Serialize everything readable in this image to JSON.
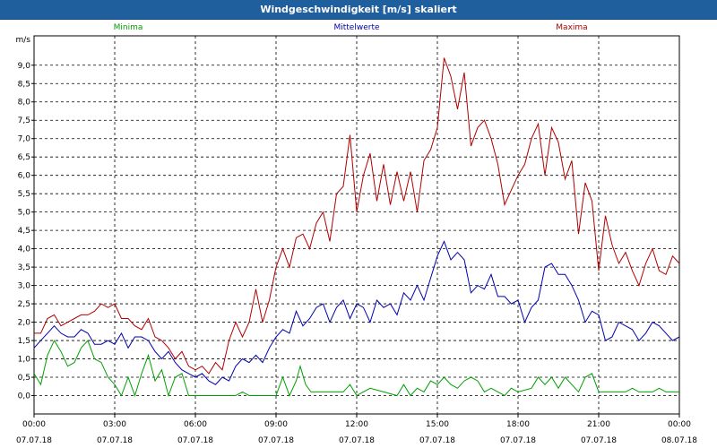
{
  "window": {
    "title": "Windgeschwindigkeit [m/s] skaliert"
  },
  "chart_data": {
    "type": "line",
    "title": "Windgeschwindigkeit [m/s] skaliert",
    "ylabel": "m/s",
    "ylim": [
      -0.5,
      9.8
    ],
    "yticks": [
      0.0,
      0.5,
      1.0,
      1.5,
      2.0,
      2.5,
      3.0,
      3.5,
      4.0,
      4.5,
      5.0,
      5.5,
      6.0,
      6.5,
      7.0,
      7.5,
      8.0,
      8.5,
      9.0
    ],
    "ytick_labels": [
      "0,0",
      "0,5",
      "1,0",
      "1,5",
      "2,0",
      "2,5",
      "3,0",
      "3,5",
      "4,0",
      "4,5",
      "5,0",
      "5,5",
      "6,0",
      "6,5",
      "7,0",
      "7,5",
      "8,0",
      "8,5",
      "9,0"
    ],
    "xlim_hours": [
      0,
      24
    ],
    "xticks": [
      {
        "h": 0,
        "time": "00:00",
        "date": "07.07.18"
      },
      {
        "h": 3,
        "time": "03:00",
        "date": "07.07.18"
      },
      {
        "h": 6,
        "time": "06:00",
        "date": "07.07.18"
      },
      {
        "h": 9,
        "time": "09:00",
        "date": "07.07.18"
      },
      {
        "h": 12,
        "time": "12:00",
        "date": "07.07.18"
      },
      {
        "h": 15,
        "time": "15:00",
        "date": "07.07.18"
      },
      {
        "h": 18,
        "time": "18:00",
        "date": "07.07.18"
      },
      {
        "h": 21,
        "time": "21:00",
        "date": "07.07.18"
      },
      {
        "h": 24,
        "time": "00:00",
        "date": "08.07.18"
      }
    ],
    "grid": true,
    "legend_placement": "top",
    "series": [
      {
        "name": "Minima",
        "color": "#00a000",
        "points": [
          [
            0,
            0.6
          ],
          [
            0.25,
            0.3
          ],
          [
            0.5,
            1.1
          ],
          [
            0.75,
            1.5
          ],
          [
            1,
            1.2
          ],
          [
            1.25,
            0.8
          ],
          [
            1.5,
            0.9
          ],
          [
            1.75,
            1.3
          ],
          [
            2,
            1.5
          ],
          [
            2.25,
            1.0
          ],
          [
            2.5,
            0.9
          ],
          [
            2.75,
            0.5
          ],
          [
            3,
            0.3
          ],
          [
            3.25,
            0.0
          ],
          [
            3.5,
            0.5
          ],
          [
            3.75,
            0.0
          ],
          [
            4,
            0.6
          ],
          [
            4.25,
            1.1
          ],
          [
            4.5,
            0.4
          ],
          [
            4.75,
            0.7
          ],
          [
            5,
            0.0
          ],
          [
            5.25,
            0.5
          ],
          [
            5.5,
            0.6
          ],
          [
            5.75,
            0.0
          ],
          [
            6,
            0.0
          ],
          [
            7,
            0.0
          ],
          [
            7.5,
            0.0
          ],
          [
            7.75,
            0.1
          ],
          [
            8,
            0.0
          ],
          [
            9,
            0.0
          ],
          [
            9.25,
            0.5
          ],
          [
            9.5,
            0.0
          ],
          [
            9.75,
            0.4
          ],
          [
            9.9,
            0.8
          ],
          [
            10.1,
            0.3
          ],
          [
            10.3,
            0.1
          ],
          [
            11,
            0.1
          ],
          [
            11.5,
            0.1
          ],
          [
            11.75,
            0.3
          ],
          [
            12,
            0.0
          ],
          [
            12.5,
            0.2
          ],
          [
            13,
            0.1
          ],
          [
            13.5,
            0.0
          ],
          [
            13.75,
            0.3
          ],
          [
            14,
            0.0
          ],
          [
            14.25,
            0.2
          ],
          [
            14.5,
            0.1
          ],
          [
            14.75,
            0.4
          ],
          [
            15,
            0.3
          ],
          [
            15.25,
            0.5
          ],
          [
            15.5,
            0.3
          ],
          [
            15.75,
            0.2
          ],
          [
            16,
            0.4
          ],
          [
            16.25,
            0.5
          ],
          [
            16.5,
            0.4
          ],
          [
            16.75,
            0.1
          ],
          [
            17,
            0.2
          ],
          [
            17.5,
            0.0
          ],
          [
            17.75,
            0.2
          ],
          [
            18,
            0.1
          ],
          [
            18.5,
            0.2
          ],
          [
            18.75,
            0.5
          ],
          [
            19,
            0.3
          ],
          [
            19.25,
            0.5
          ],
          [
            19.5,
            0.2
          ],
          [
            19.75,
            0.5
          ],
          [
            20,
            0.3
          ],
          [
            20.25,
            0.1
          ],
          [
            20.5,
            0.5
          ],
          [
            20.75,
            0.6
          ],
          [
            21,
            0.1
          ],
          [
            22,
            0.1
          ],
          [
            22.25,
            0.2
          ],
          [
            22.5,
            0.1
          ],
          [
            23,
            0.1
          ],
          [
            23.25,
            0.2
          ],
          [
            23.5,
            0.1
          ],
          [
            24,
            0.1
          ]
        ]
      },
      {
        "name": "Mittelwerte",
        "color": "#0000b0",
        "points": [
          [
            0,
            1.3
          ],
          [
            0.25,
            1.5
          ],
          [
            0.5,
            1.7
          ],
          [
            0.75,
            1.9
          ],
          [
            1,
            1.7
          ],
          [
            1.25,
            1.6
          ],
          [
            1.5,
            1.6
          ],
          [
            1.75,
            1.8
          ],
          [
            2,
            1.7
          ],
          [
            2.25,
            1.4
          ],
          [
            2.5,
            1.4
          ],
          [
            2.75,
            1.5
          ],
          [
            3,
            1.4
          ],
          [
            3.25,
            1.7
          ],
          [
            3.5,
            1.3
          ],
          [
            3.75,
            1.6
          ],
          [
            4,
            1.6
          ],
          [
            4.25,
            1.5
          ],
          [
            4.5,
            1.2
          ],
          [
            4.75,
            1.0
          ],
          [
            5,
            1.2
          ],
          [
            5.25,
            0.9
          ],
          [
            5.5,
            0.7
          ],
          [
            5.75,
            0.6
          ],
          [
            6,
            0.5
          ],
          [
            6.25,
            0.6
          ],
          [
            6.5,
            0.4
          ],
          [
            6.75,
            0.3
          ],
          [
            7,
            0.5
          ],
          [
            7.25,
            0.4
          ],
          [
            7.5,
            0.8
          ],
          [
            7.75,
            1.0
          ],
          [
            8,
            0.9
          ],
          [
            8.25,
            1.1
          ],
          [
            8.5,
            0.9
          ],
          [
            8.75,
            1.3
          ],
          [
            9,
            1.6
          ],
          [
            9.25,
            1.8
          ],
          [
            9.5,
            1.7
          ],
          [
            9.75,
            2.3
          ],
          [
            10,
            1.9
          ],
          [
            10.25,
            2.1
          ],
          [
            10.5,
            2.4
          ],
          [
            10.75,
            2.5
          ],
          [
            11,
            2.0
          ],
          [
            11.25,
            2.4
          ],
          [
            11.5,
            2.6
          ],
          [
            11.75,
            2.1
          ],
          [
            12,
            2.5
          ],
          [
            12.25,
            2.4
          ],
          [
            12.5,
            2.0
          ],
          [
            12.75,
            2.6
          ],
          [
            13,
            2.4
          ],
          [
            13.25,
            2.5
          ],
          [
            13.5,
            2.2
          ],
          [
            13.75,
            2.8
          ],
          [
            14,
            2.6
          ],
          [
            14.25,
            3.0
          ],
          [
            14.5,
            2.6
          ],
          [
            14.75,
            3.2
          ],
          [
            15,
            3.8
          ],
          [
            15.25,
            4.2
          ],
          [
            15.5,
            3.7
          ],
          [
            15.75,
            3.9
          ],
          [
            16,
            3.7
          ],
          [
            16.25,
            2.8
          ],
          [
            16.5,
            3.0
          ],
          [
            16.75,
            2.9
          ],
          [
            17,
            3.3
          ],
          [
            17.25,
            2.7
          ],
          [
            17.5,
            2.7
          ],
          [
            17.75,
            2.5
          ],
          [
            18,
            2.6
          ],
          [
            18.25,
            2.0
          ],
          [
            18.5,
            2.4
          ],
          [
            18.75,
            2.6
          ],
          [
            19,
            3.5
          ],
          [
            19.25,
            3.6
          ],
          [
            19.5,
            3.3
          ],
          [
            19.75,
            3.3
          ],
          [
            20,
            3.0
          ],
          [
            20.25,
            2.6
          ],
          [
            20.5,
            2.0
          ],
          [
            20.75,
            2.3
          ],
          [
            21,
            2.2
          ],
          [
            21.25,
            1.5
          ],
          [
            21.5,
            1.6
          ],
          [
            21.75,
            2.0
          ],
          [
            22,
            1.9
          ],
          [
            22.25,
            1.8
          ],
          [
            22.5,
            1.5
          ],
          [
            22.75,
            1.7
          ],
          [
            23,
            2.0
          ],
          [
            23.25,
            1.9
          ],
          [
            23.5,
            1.7
          ],
          [
            23.75,
            1.5
          ],
          [
            24,
            1.6
          ]
        ]
      },
      {
        "name": "Maxima",
        "color": "#b00000",
        "points": [
          [
            0,
            1.7
          ],
          [
            0.25,
            1.7
          ],
          [
            0.5,
            2.1
          ],
          [
            0.75,
            2.2
          ],
          [
            1,
            1.9
          ],
          [
            1.25,
            2.0
          ],
          [
            1.5,
            2.1
          ],
          [
            1.75,
            2.2
          ],
          [
            2,
            2.2
          ],
          [
            2.25,
            2.3
          ],
          [
            2.5,
            2.5
          ],
          [
            2.75,
            2.4
          ],
          [
            3,
            2.5
          ],
          [
            3.25,
            2.1
          ],
          [
            3.5,
            2.1
          ],
          [
            3.75,
            1.9
          ],
          [
            4,
            1.8
          ],
          [
            4.25,
            2.1
          ],
          [
            4.5,
            1.6
          ],
          [
            4.75,
            1.5
          ],
          [
            5,
            1.3
          ],
          [
            5.25,
            1.0
          ],
          [
            5.5,
            1.2
          ],
          [
            5.75,
            0.8
          ],
          [
            6,
            0.7
          ],
          [
            6.25,
            0.8
          ],
          [
            6.5,
            0.6
          ],
          [
            6.75,
            0.9
          ],
          [
            7,
            0.7
          ],
          [
            7.25,
            1.5
          ],
          [
            7.5,
            2.0
          ],
          [
            7.75,
            1.6
          ],
          [
            8,
            2.0
          ],
          [
            8.25,
            2.9
          ],
          [
            8.5,
            2.0
          ],
          [
            8.75,
            2.6
          ],
          [
            9,
            3.5
          ],
          [
            9.25,
            4.0
          ],
          [
            9.5,
            3.5
          ],
          [
            9.75,
            4.3
          ],
          [
            10,
            4.4
          ],
          [
            10.25,
            4.0
          ],
          [
            10.5,
            4.7
          ],
          [
            10.75,
            5.0
          ],
          [
            11,
            4.2
          ],
          [
            11.25,
            5.5
          ],
          [
            11.5,
            5.7
          ],
          [
            11.75,
            7.1
          ],
          [
            12,
            5.0
          ],
          [
            12.25,
            6.0
          ],
          [
            12.5,
            6.6
          ],
          [
            12.75,
            5.3
          ],
          [
            13,
            6.3
          ],
          [
            13.25,
            5.2
          ],
          [
            13.5,
            6.1
          ],
          [
            13.75,
            5.3
          ],
          [
            14,
            6.1
          ],
          [
            14.25,
            5.0
          ],
          [
            14.5,
            6.4
          ],
          [
            14.75,
            6.7
          ],
          [
            15,
            7.3
          ],
          [
            15.25,
            9.2
          ],
          [
            15.5,
            8.7
          ],
          [
            15.75,
            7.8
          ],
          [
            16,
            8.8
          ],
          [
            16.25,
            6.8
          ],
          [
            16.5,
            7.3
          ],
          [
            16.75,
            7.5
          ],
          [
            17,
            7.0
          ],
          [
            17.25,
            6.3
          ],
          [
            17.5,
            5.2
          ],
          [
            17.75,
            5.6
          ],
          [
            18,
            6.0
          ],
          [
            18.25,
            6.3
          ],
          [
            18.5,
            7.0
          ],
          [
            18.75,
            7.4
          ],
          [
            19,
            6.0
          ],
          [
            19.25,
            7.3
          ],
          [
            19.5,
            6.9
          ],
          [
            19.75,
            5.9
          ],
          [
            20,
            6.4
          ],
          [
            20.25,
            4.4
          ],
          [
            20.5,
            5.8
          ],
          [
            20.75,
            5.3
          ],
          [
            21,
            3.4
          ],
          [
            21.25,
            4.9
          ],
          [
            21.5,
            4.1
          ],
          [
            21.75,
            3.6
          ],
          [
            22,
            3.9
          ],
          [
            22.25,
            3.4
          ],
          [
            22.5,
            3.0
          ],
          [
            22.75,
            3.6
          ],
          [
            23,
            4.0
          ],
          [
            23.25,
            3.4
          ],
          [
            23.5,
            3.3
          ],
          [
            23.75,
            3.8
          ],
          [
            24,
            3.6
          ]
        ]
      }
    ]
  }
}
